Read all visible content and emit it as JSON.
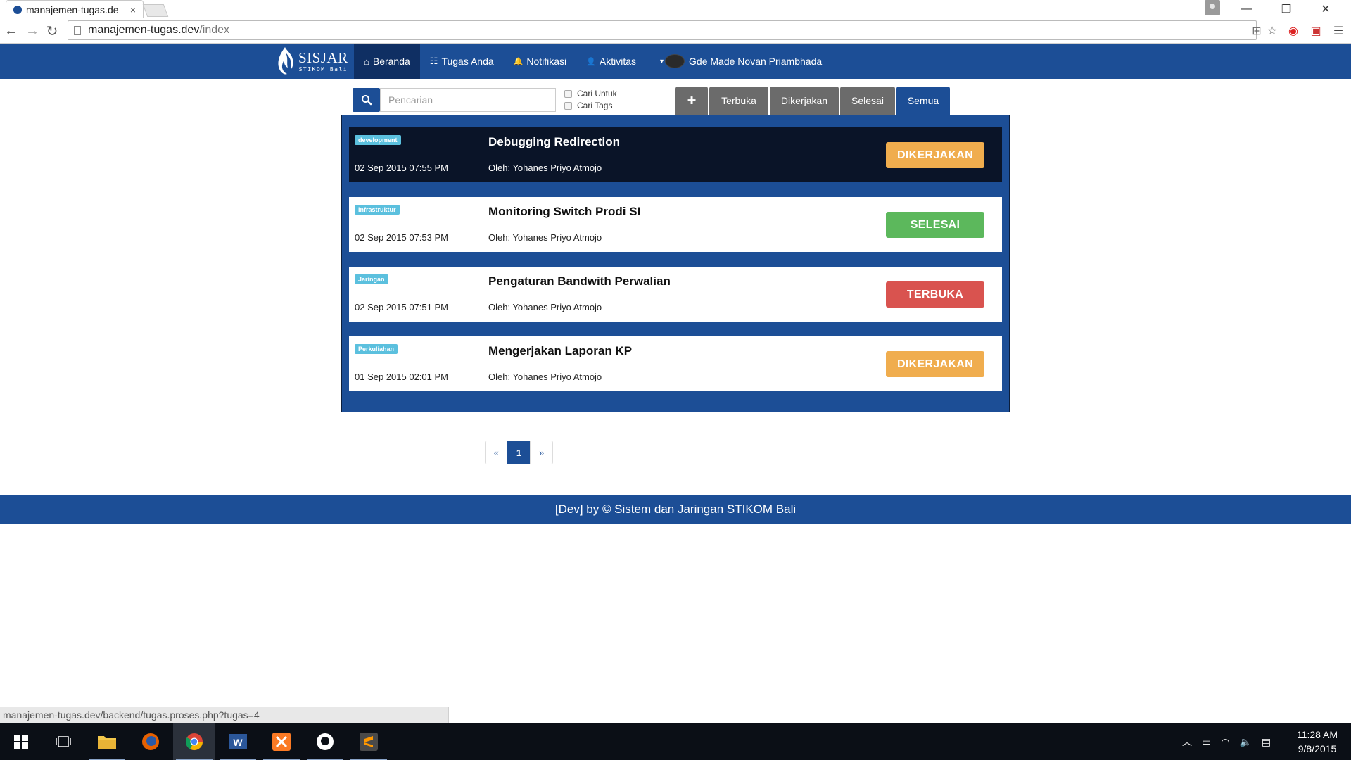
{
  "browser": {
    "tab_title": "manajemen-tugas.de",
    "tab_close": "×",
    "url_host": "manajemen-tugas.dev",
    "url_path": "/index",
    "window_minimize": "—",
    "window_restore": "❐",
    "window_close": "✕"
  },
  "site": {
    "brand_title": "SISJAR",
    "brand_sub": "STIKOM Bali",
    "nav": [
      {
        "label": "Beranda",
        "icon": "home-icon",
        "glyph": "⌂"
      },
      {
        "label": "Tugas Anda",
        "icon": "table-icon",
        "glyph": "☷"
      },
      {
        "label": "Notifikasi",
        "icon": "bell-icon",
        "glyph": "🔔"
      },
      {
        "label": "Aktivitas",
        "icon": "user-icon",
        "glyph": "👤"
      }
    ],
    "user_name": "Gde Made Novan Priambhada",
    "caret": "▾"
  },
  "search": {
    "placeholder": "Pencarian",
    "option_1": "Cari Untuk",
    "option_2": "Cari Tags"
  },
  "filters": {
    "add": "✚",
    "tabs": [
      "Terbuka",
      "Dikerjakan",
      "Selesai",
      "Semua"
    ],
    "active": "Semua"
  },
  "tasks": [
    {
      "tag": "development",
      "title": "Debugging Redirection",
      "date": "02 Sep 2015 07:55 PM",
      "author": "Oleh: Yohanes Priyo Atmojo",
      "status": "DIKERJAKAN",
      "status_color": "#f0ad4e",
      "highlighted": true
    },
    {
      "tag": "Infrastruktur",
      "title": "Monitoring Switch Prodi SI",
      "date": "02 Sep 2015 07:53 PM",
      "author": "Oleh: Yohanes Priyo Atmojo",
      "status": "SELESAI",
      "status_color": "#5cb85c",
      "highlighted": false
    },
    {
      "tag": "Jaringan",
      "title": "Pengaturan Bandwith Perwalian",
      "date": "02 Sep 2015 07:51 PM",
      "author": "Oleh: Yohanes Priyo Atmojo",
      "status": "TERBUKA",
      "status_color": "#d9534f",
      "highlighted": false
    },
    {
      "tag": "Perkuliahan",
      "title": "Mengerjakan Laporan KP",
      "date": "01 Sep 2015 02:01 PM",
      "author": "Oleh: Yohanes Priyo Atmojo",
      "status": "DIKERJAKAN",
      "status_color": "#f0ad4e",
      "highlighted": false
    }
  ],
  "pagination": {
    "prev": "«",
    "current": "1",
    "next": "»"
  },
  "footer": "[Dev] by © Sistem dan Jaringan STIKOM Bali",
  "status_bar_url": "manajemen-tugas.dev/backend/tugas.proses.php?tugas=4",
  "taskbar": {
    "time": "11:28 AM",
    "date": "9/8/2015"
  },
  "colors": {
    "brand_blue": "#1c4e96",
    "nav_active": "#0f2f63"
  }
}
